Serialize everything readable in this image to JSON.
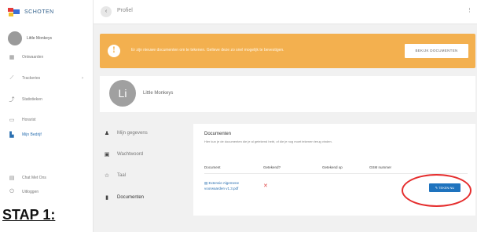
{
  "brand": {
    "name": "SCHOTEN",
    "logo_colors": [
      "#e63a3a",
      "#3a6fd8",
      "#f4c02a"
    ]
  },
  "user": {
    "name": "Little Monkeys"
  },
  "sidebar": {
    "items": [
      {
        "label": "Ontwaarden",
        "icon": "grid-icon"
      },
      {
        "label": "Trackeries",
        "icon": "chart-icon",
        "chevron": "›"
      },
      {
        "label": "Statistieken",
        "icon": "trend-icon"
      },
      {
        "label": "Horarist",
        "icon": "calendar-icon"
      },
      {
        "label": "Mijn Bedrijf",
        "icon": "building-icon",
        "active": true
      },
      {
        "label": "Chat Met Ons",
        "icon": "chat-icon"
      },
      {
        "label": "Uitloggen",
        "icon": "power-icon"
      }
    ]
  },
  "annotation": {
    "step_label": "STAP 1:"
  },
  "topbar": {
    "back_icon": "‹",
    "title": "Profiel",
    "menu_icon": "⋮"
  },
  "banner": {
    "icon": "!",
    "text": "Er zijn nieuwe documenten om te tekenen. Gelieve deze zo snel mogelijk te bevestigen.",
    "button_label": "BEKIJK DOCUMENTEN",
    "color": "#f3b04f"
  },
  "profile": {
    "initials": "Li",
    "name": "Little Monkeys"
  },
  "profile_menu": [
    {
      "label": "Mijn gegevens",
      "icon": "user-icon"
    },
    {
      "label": "Wachtwoord",
      "icon": "lock-icon"
    },
    {
      "label": "Taal",
      "icon": "star-icon"
    },
    {
      "label": "Documenten",
      "icon": "document-icon",
      "active": true
    }
  ],
  "documents": {
    "title": "Documenten",
    "subtitle": "Hier kun je de documenten die je al getekend hebt, of die je nog moet tekenen terug vinden.",
    "columns": [
      "Document",
      "Getekend?",
      "Getekend op",
      "GSM nummer"
    ],
    "rows": [
      {
        "name": "Extensie Algemene voorwaarden v1.3.pdf",
        "signed": "✕",
        "signed_on": "",
        "gsm": "",
        "action": "✎ TEKEN NU"
      }
    ]
  },
  "colors": {
    "accent": "#1e73be",
    "highlight": "#e52d2d",
    "error": "#e04b4b"
  }
}
